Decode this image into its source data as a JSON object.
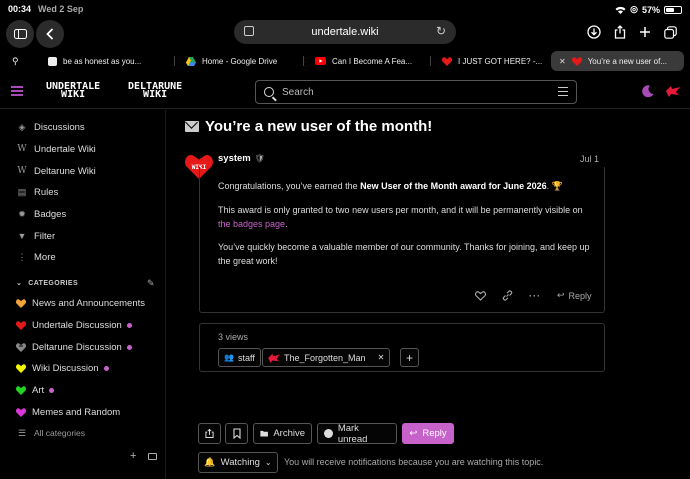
{
  "status": {
    "time": "00:34",
    "date": "Wed 2 Sep",
    "battery": "57%"
  },
  "browser": {
    "url": "undertale.wiki",
    "tabs": [
      {
        "label": "be as honest as you..."
      },
      {
        "label": "Home - Google Drive"
      },
      {
        "label": "Can I Become A Fea..."
      },
      {
        "label": "I JUST GOT HERE? -..."
      },
      {
        "label": "You’re a new user of..."
      }
    ]
  },
  "header": {
    "logo_undertale": "UNDERTALE",
    "logo_undertale_sub": "WIKI",
    "logo_deltarune": "DELTARUNE",
    "logo_deltarune_sub": "WIKI",
    "search_placeholder": "Search"
  },
  "sidebar": {
    "items": [
      {
        "label": "Discussions",
        "icon": "layers-icon"
      },
      {
        "label": "Undertale Wiki",
        "icon": "wikipedia-icon"
      },
      {
        "label": "Deltarune Wiki",
        "icon": "wikipedia-icon"
      },
      {
        "label": "Rules",
        "icon": "document-icon"
      },
      {
        "label": "Badges",
        "icon": "badge-icon"
      },
      {
        "label": "Filter",
        "icon": "filter-icon"
      },
      {
        "label": "More",
        "icon": "more-icon"
      }
    ],
    "categories_heading": "CATEGORIES",
    "categories": [
      {
        "label": "News and Announcements",
        "color": "#f2a33a",
        "unread": false
      },
      {
        "label": "Undertale Discussion",
        "color": "#e61919",
        "unread": true
      },
      {
        "label": "Deltarune Discussion",
        "color": "#888888",
        "unread": true
      },
      {
        "label": "Wiki Discussion",
        "color": "#f5f500",
        "unread": true
      },
      {
        "label": "Art",
        "color": "#22d422",
        "unread": true
      },
      {
        "label": "Memes and Random",
        "color": "#d936d9",
        "unread": false
      }
    ],
    "all_categories": "All categories"
  },
  "topic": {
    "title": "You’re a new user of the month!",
    "author": "system",
    "date": "Jul 1",
    "avatar_text": "WIKI",
    "p1_pre": "Congratulations, you’ve earned the ",
    "p1_bold": "New User of the Month award for June 2026",
    "p1_post": ". 🏆",
    "p2_pre": "This award is only granted to two new users per month, and it will be permanently visible on ",
    "p2_link": "the badges page",
    "p2_post": ".",
    "p3": "You’ve quickly become a valuable member of our community. Thanks for joining, and keep up the great work!",
    "reply_label": "Reply",
    "views": "3 views",
    "chips": [
      {
        "label": "staff"
      },
      {
        "label": "The_Forgotten_Man"
      }
    ]
  },
  "footer": {
    "archive": "Archive",
    "mark_unread": "Mark unread",
    "reply": "Reply",
    "watching": "Watching",
    "notice": "You will receive notifications because you are watching this topic."
  },
  "colors": {
    "accent": "#c862cb",
    "background": "#000000"
  }
}
